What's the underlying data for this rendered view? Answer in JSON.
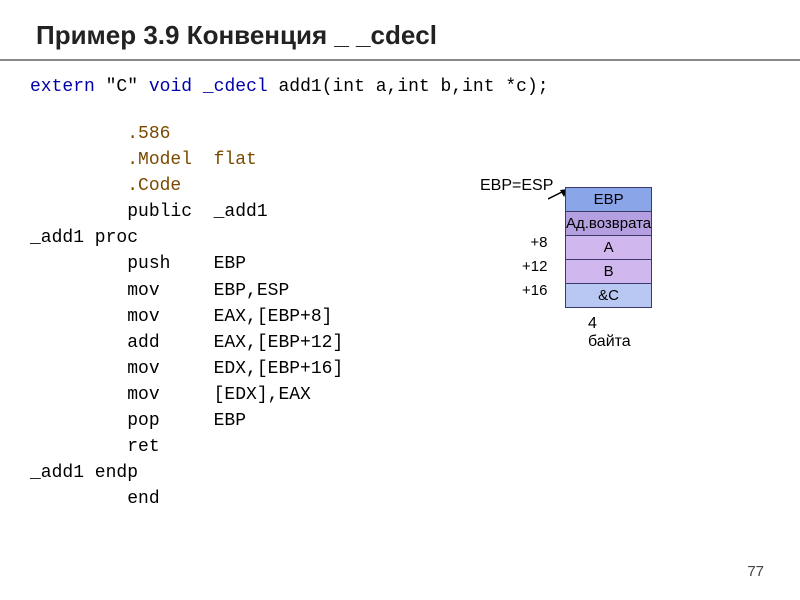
{
  "title": "Пример 3.9 Конвенция _ _cdecl",
  "decl": {
    "extern_kw": "extern",
    "quote": "\"C\"",
    "void_kw": "void",
    "cdecl_kw": "_cdecl",
    "fn": "add1(int a,int b,int *c);"
  },
  "asm": {
    "l1": "         .586",
    "l2": "         .Model  flat",
    "l3": "         .Code",
    "l4": "         public  _add1",
    "l5": "_add1 proc",
    "l6": "         push    EBP",
    "l7": "         mov     EBP,ESP",
    "l8": "         mov     EAX,[EBP+8]",
    "l9": "         add     EAX,[EBP+12]",
    "l10": "         mov     EDX,[EBP+16]",
    "l11": "         mov     [EDX],EAX",
    "l12": "         pop     EBP",
    "l13": "         ret",
    "l14": "_add1 endp",
    "l15": "         end"
  },
  "stack": {
    "ebp_label": "EBP=ESP",
    "offsets": {
      "o1": "+8",
      "o2": "+12",
      "o3": "+16"
    },
    "cells": {
      "c0": "EBP",
      "c1": "Ад.возврата",
      "c2": "A",
      "c3": "B",
      "c4": "&C"
    },
    "colors": {
      "c0": "#8aa6e8",
      "c1": "#b4a0e0",
      "c2": "#d0b8ee",
      "c3": "#d0b8ee",
      "c4": "#b8c8f2"
    },
    "caption": "4 байта"
  },
  "page_number": "77"
}
